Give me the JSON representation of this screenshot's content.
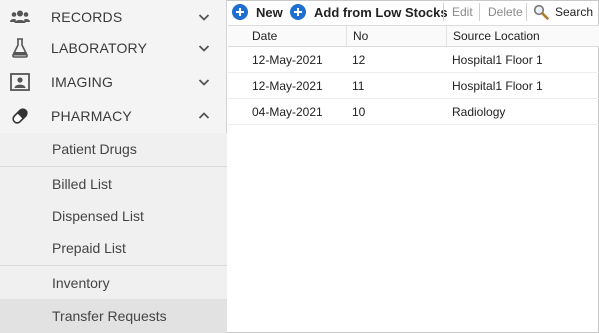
{
  "sidebar": {
    "items": [
      {
        "label": "RECORDS",
        "icon": "users-icon",
        "expanded": false
      },
      {
        "label": "LABORATORY",
        "icon": "flask-icon",
        "expanded": false
      },
      {
        "label": "IMAGING",
        "icon": "image-portrait-icon",
        "expanded": false
      },
      {
        "label": "PHARMACY",
        "icon": "pill-icon",
        "expanded": true
      }
    ],
    "pharmacy_subitems": [
      {
        "label": "Patient Drugs"
      },
      {
        "label": "Billed List"
      },
      {
        "label": "Dispensed List"
      },
      {
        "label": "Prepaid List"
      },
      {
        "label": "Inventory"
      },
      {
        "label": "Transfer Requests",
        "active": true
      }
    ]
  },
  "toolbar": {
    "new_label": "New",
    "add_low_stock_label": "Add from Low Stocks",
    "edit_label": "Edit",
    "delete_label": "Delete",
    "search_label": "Search"
  },
  "table": {
    "columns": [
      "Date",
      "No",
      "Source Location"
    ],
    "rows": [
      {
        "date": "12-May-2021",
        "no": "12",
        "source": "Hospital1 Floor 1"
      },
      {
        "date": "12-May-2021",
        "no": "11",
        "source": "Hospital1 Floor 1"
      },
      {
        "date": "04-May-2021",
        "no": "10",
        "source": "Radiology"
      }
    ]
  },
  "colors": {
    "accent": "#1e6fcf",
    "sidebar_bg": "#f4f4f4",
    "active_bg": "#e2e2e2"
  }
}
